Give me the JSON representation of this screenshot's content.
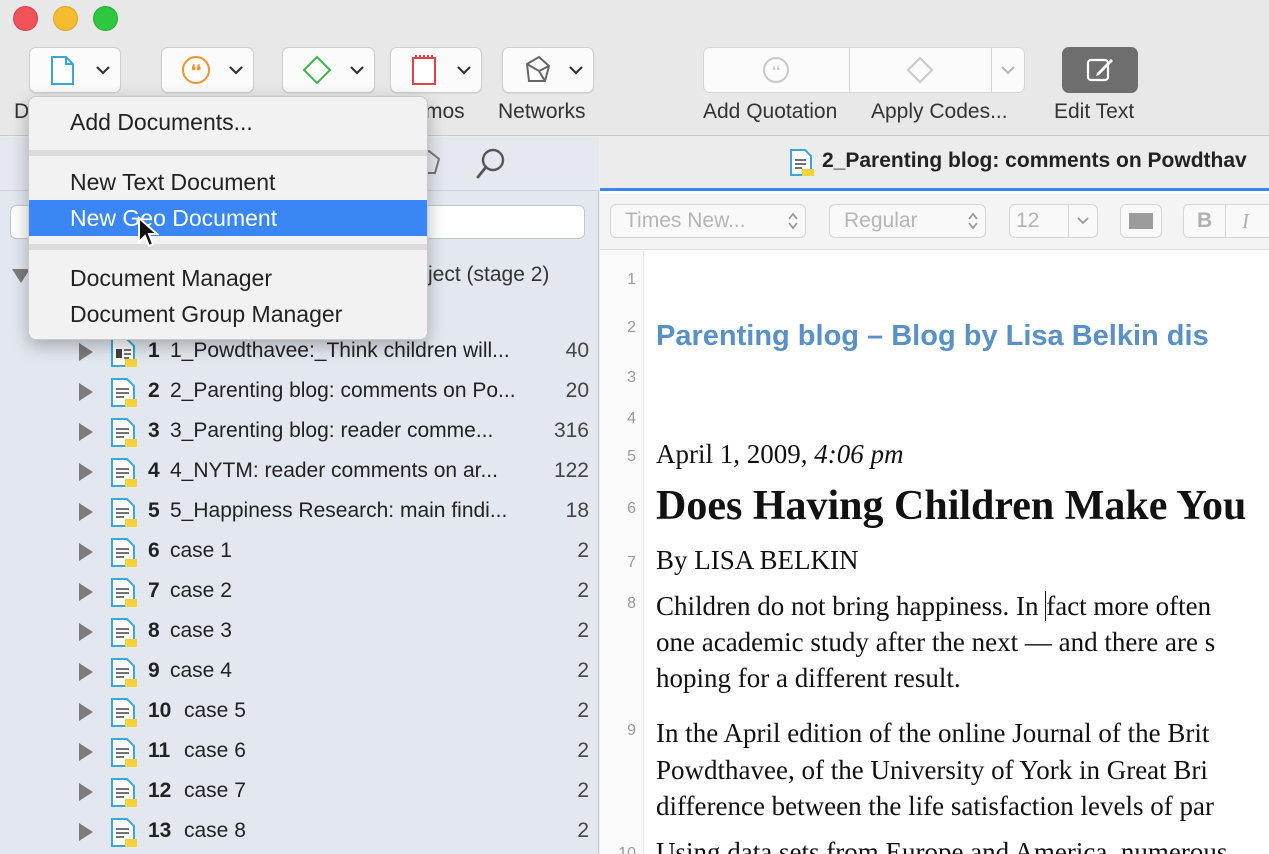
{
  "toolbar": {
    "labels": {
      "documents_partial": "D",
      "memos_partial": "mos",
      "networks": "Networks",
      "add_quotation": "Add Quotation",
      "apply_codes": "Apply Codes...",
      "edit_text": "Edit Text"
    },
    "icons": [
      "document-icon",
      "quotation-icon",
      "code-icon",
      "memo-icon",
      "network-icon",
      "add-quotation-icon",
      "apply-codes-icon",
      "edit-text-icon"
    ]
  },
  "menu": {
    "items": [
      {
        "label": "Add Documents..."
      },
      {
        "label": "New Text Document"
      },
      {
        "label": "New Geo Document"
      },
      {
        "label": "Document Manager"
      },
      {
        "label": "Document Group Manager"
      }
    ],
    "highlighted": "New Geo Document"
  },
  "navigator": {
    "project_label": "ject (stage 2)",
    "documents": [
      {
        "num": "1",
        "name": "1_Powdthavee:_Think children will...",
        "count": "40"
      },
      {
        "num": "2",
        "name": "2_Parenting blog: comments on Po...",
        "count": "20"
      },
      {
        "num": "3",
        "name": "3_Parenting blog: reader comme...",
        "count": "316"
      },
      {
        "num": "4",
        "name": "4_NYTM: reader comments on ar...",
        "count": "122"
      },
      {
        "num": "5",
        "name": "5_Happiness Research: main findi...",
        "count": "18"
      },
      {
        "num": "6",
        "name": "case 1",
        "count": "2"
      },
      {
        "num": "7",
        "name": "case 2",
        "count": "2"
      },
      {
        "num": "8",
        "name": "case 3",
        "count": "2"
      },
      {
        "num": "9",
        "name": "case 4",
        "count": "2"
      },
      {
        "num": "10",
        "name": "case 5",
        "count": "2"
      },
      {
        "num": "11",
        "name": "case 6",
        "count": "2"
      },
      {
        "num": "12",
        "name": "case 7",
        "count": "2"
      },
      {
        "num": "13",
        "name": "case 8",
        "count": "2"
      }
    ]
  },
  "editor": {
    "tab_title": "2_Parenting blog: comments on Powdthav",
    "format": {
      "font": "Times New...",
      "style": "Regular",
      "size": "12",
      "bold": "B",
      "italic": "I"
    },
    "line_numbers": [
      "1",
      "2",
      "3",
      "4",
      "5",
      "6",
      "7",
      "8",
      "9",
      "10"
    ],
    "content": {
      "blog_title": "Parenting blog – Blog by Lisa Belkin dis",
      "date": "April 1, 2009,",
      "time": "4:06 pm",
      "headline": "Does Having Children Make You",
      "byline": "By LISA BELKIN",
      "p1_l1a": "Children do not bring happiness. In ",
      "p1_l1b": "fact more often",
      "p1_l2": "one academic study after the next — and there are s",
      "p1_l3": "hoping for a different result.",
      "p2_l1": "In the April edition of the online Journal of the Brit",
      "p2_l2": "Powdthavee, of the University of York in Great Bri",
      "p2_l3": "difference between the life satisfaction levels of par",
      "p3_l1": "Using data sets from Europe and America, numerous"
    }
  },
  "colors": {
    "accent": "#3a86f5",
    "blue_title": "#5a90c8",
    "doc_icon": "#3aa7d8",
    "code_icon": "#3fb64a",
    "quote_icon": "#f0922e",
    "memo_icon": "#e0424a"
  }
}
